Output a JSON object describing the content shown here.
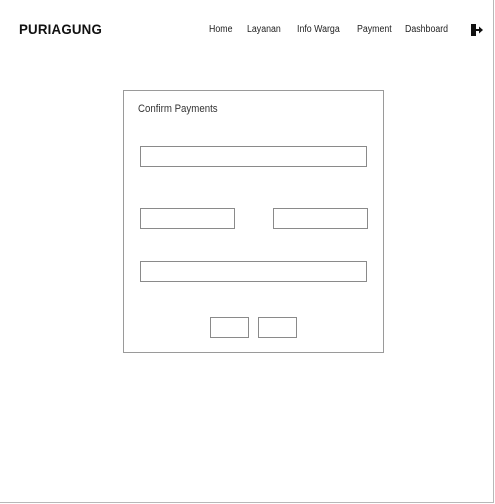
{
  "brand": {
    "name": "PURIAGUNG"
  },
  "nav": {
    "items": [
      {
        "label": "Home",
        "icon": null
      },
      {
        "label": "Layanan",
        "icon": null
      },
      {
        "label": "Info Warga",
        "icon": null
      },
      {
        "label": "Payment",
        "icon": null
      },
      {
        "label": "Dashboard",
        "icon": null
      }
    ],
    "logout_icon": "logout-icon"
  },
  "card": {
    "title": "Confirm Payments",
    "fields": [
      {
        "value": "",
        "placeholder": ""
      },
      {
        "value": "",
        "placeholder": ""
      },
      {
        "value": "",
        "placeholder": ""
      },
      {
        "value": "",
        "placeholder": ""
      }
    ],
    "buttons": [
      {
        "label": ""
      },
      {
        "label": ""
      }
    ]
  },
  "colors": {
    "border": "#8a8a8a",
    "text": "#222222",
    "background": "#ffffff"
  }
}
